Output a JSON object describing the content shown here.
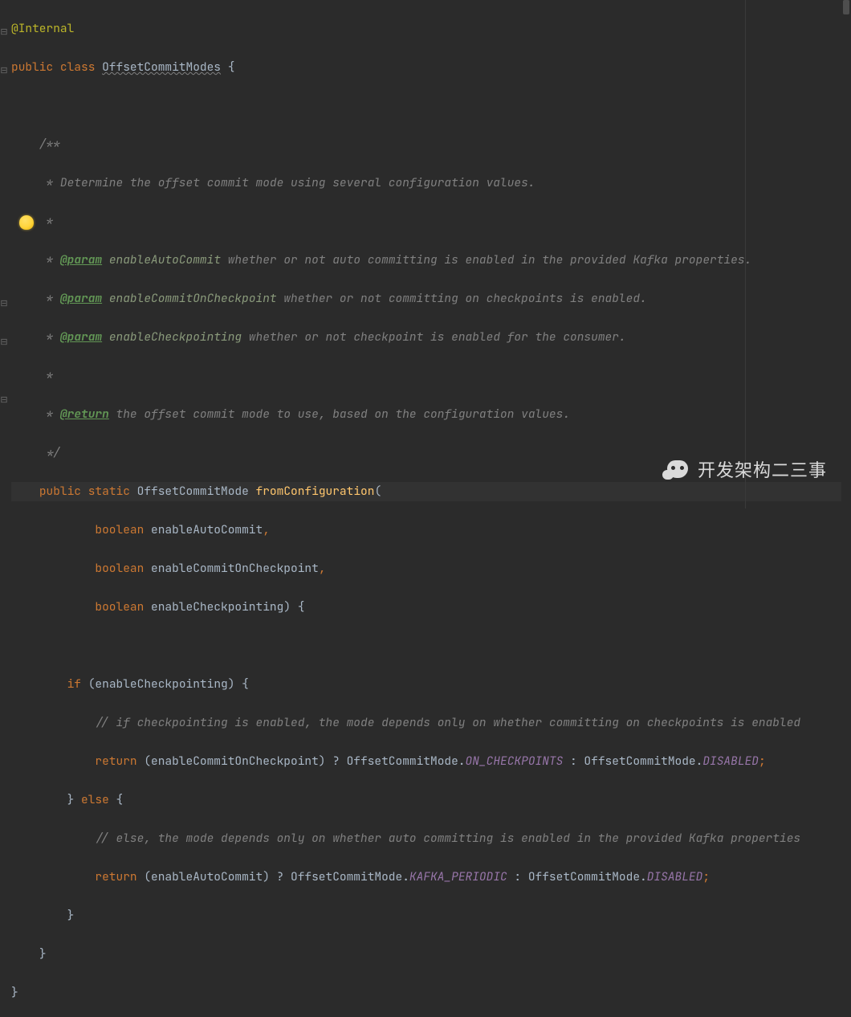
{
  "annotation": "@Internal",
  "decl": {
    "public": "public",
    "class": "class",
    "name": "OffsetCommitModes",
    "brace": " {"
  },
  "doc": {
    "open": "/**",
    "l1": " * Determine the offset commit mode using several configuration values.",
    "l2": " *",
    "p1_tag": "@param",
    "p1_name": " enableAutoCommit",
    "p1_txt": " whether or not auto committing is enabled in the provided Kafka properties.",
    "p2_tag": "@param",
    "p2_name": " enableCommitOnCheckpoint",
    "p2_txt": " whether or not committing on checkpoints is enabled.",
    "p3_tag": "@param",
    "p3_name": " enableCheckpointing",
    "p3_txt": " whether or not checkpoint is enabled for the consumer.",
    "l3": " *",
    "ret_tag": "@return",
    "ret_txt": " the offset commit mode to use, based on the configuration values.",
    "close": " */"
  },
  "method": {
    "public": "public",
    "static": "static",
    "ret": "OffsetCommitMode ",
    "name": "fromConfiguration",
    "open": "(",
    "bool": "boolean",
    "a1": " enableAutoCommit",
    "c1": ",",
    "a2": " enableCommitOnCheckpoint",
    "c2": ",",
    "a3": " enableCheckpointing",
    "close": ") {"
  },
  "body": {
    "if": "if",
    "ifcond": " (enableCheckpointing) {",
    "cm1": "// if checkpointing is enabled, the mode depends only on whether committing on checkpoints is enabled",
    "ret": "return",
    "r1a": " (enableCommitOnCheckpoint) ? OffsetCommitMode.",
    "ON": "ON_CHECKPOINTS",
    "r1b": " : OffsetCommitMode.",
    "DIS": "DISABLED",
    "semi": ";",
    "elseclose": "} ",
    "else": "else",
    "elsebrace": " {",
    "cm2": "// else, the mode depends only on whether auto committing is enabled in the provided Kafka properties",
    "r2a": " (enableAutoCommit) ? OffsetCommitMode.",
    "KP": "KAFKA_PERIODIC",
    "r2b": " : OffsetCommitMode.",
    "endbrace": "}"
  },
  "watermark": "开发架构二三事"
}
